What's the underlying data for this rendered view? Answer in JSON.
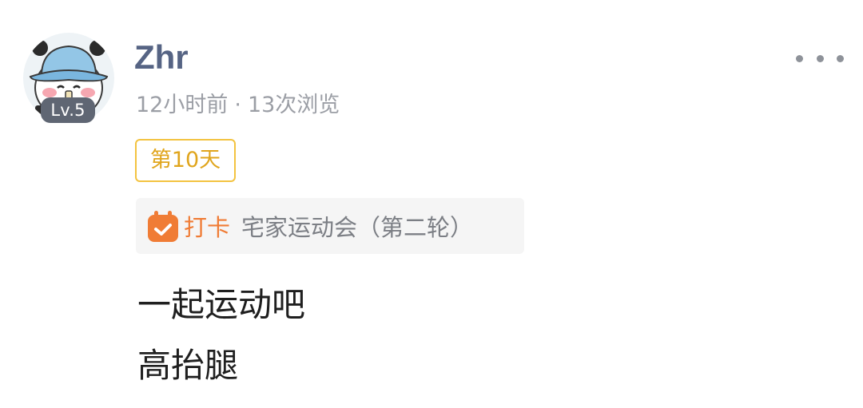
{
  "post": {
    "author": {
      "name": "Zhr",
      "level": "Lv.5",
      "avatar_icon": "panda-bucket-hat-avatar"
    },
    "meta": {
      "time": "12小时前",
      "separator": "·",
      "views": "13次浏览"
    },
    "more_icon": "more-dots-icon",
    "day_tag": "第10天",
    "checkin": {
      "icon": "calendar-check-icon",
      "label": "打卡",
      "event": "宅家运动会（第二轮）"
    },
    "content_lines": [
      "一起运动吧",
      "高抬腿"
    ]
  },
  "colors": {
    "username": "#566484",
    "meta": "#9b9ea5",
    "tag_border": "#f3c340",
    "tag_text": "#e0a51c",
    "checkin_accent": "#f07c35",
    "checkin_bg": "#f5f5f5",
    "level_badge": "#5f6673",
    "body_text": "#1f1f1f"
  }
}
